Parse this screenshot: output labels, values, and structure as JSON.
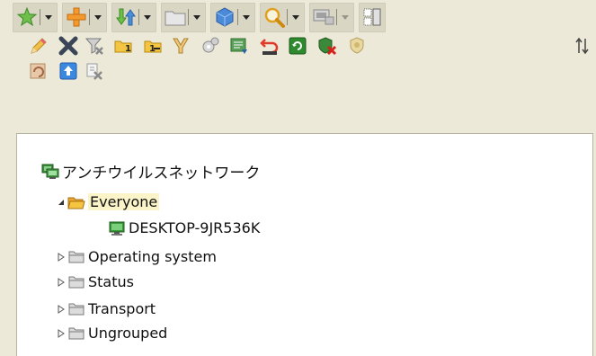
{
  "toolbar": {
    "groups": [
      {
        "icon": "star-icon"
      },
      {
        "icon": "add-icon"
      },
      {
        "icon": "install-icon"
      },
      {
        "icon": "folder-icon"
      },
      {
        "icon": "cube-icon"
      },
      {
        "icon": "search-icon"
      },
      {
        "icon": "remote-icon"
      },
      {
        "icon": "layout-icon"
      }
    ]
  },
  "actions": {
    "row1": [
      "pencil-icon",
      "delete-icon",
      "filter-icon",
      "step1-icon",
      "step1-alt-icon",
      "merge-icon",
      "settings-icon",
      "list-icon",
      "undo-icon",
      "refresh-icon",
      "shield-remove-icon",
      "shield-icon",
      "sort-icon"
    ],
    "row2": [
      "history-icon",
      "upload-icon",
      "clear-icon"
    ]
  },
  "tree": {
    "root": "アンチウイルスネットワーク",
    "groups": [
      {
        "label": "Everyone",
        "expanded": true,
        "children": [
          "DESKTOP-9JR536K"
        ]
      },
      {
        "label": "Operating system",
        "expanded": false
      },
      {
        "label": "Status",
        "expanded": false
      },
      {
        "label": "Transport",
        "expanded": false
      },
      {
        "label": "Ungrouped",
        "expanded": false
      }
    ]
  },
  "colors": {
    "background": "#ece9d8",
    "panel": "#ffffff",
    "selection": "#fbf4c8",
    "folder": "#d9d9d9",
    "folder_open": "#f5c542"
  }
}
